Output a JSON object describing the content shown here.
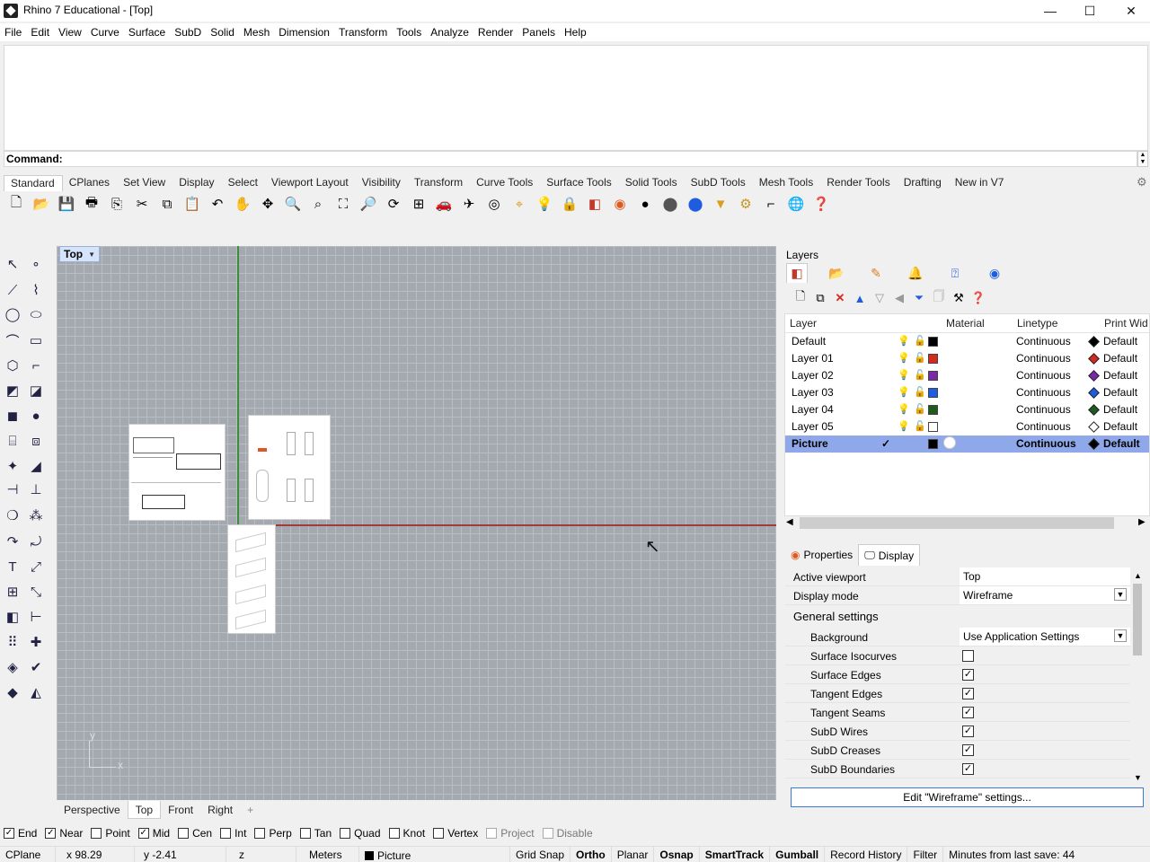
{
  "window": {
    "title": "Rhino 7 Educational - [Top]",
    "minimize": "—",
    "maximize": "☐",
    "close": "✕"
  },
  "menu": [
    "File",
    "Edit",
    "View",
    "Curve",
    "Surface",
    "SubD",
    "Solid",
    "Mesh",
    "Dimension",
    "Transform",
    "Tools",
    "Analyze",
    "Render",
    "Panels",
    "Help"
  ],
  "command": {
    "label": "Command:"
  },
  "toolbar_tabs": [
    "Standard",
    "CPlanes",
    "Set View",
    "Display",
    "Select",
    "Viewport Layout",
    "Visibility",
    "Transform",
    "Curve Tools",
    "Surface Tools",
    "Solid Tools",
    "SubD Tools",
    "Mesh Tools",
    "Render Tools",
    "Drafting",
    "New in V7"
  ],
  "toolbar_icons": [
    "new-icon",
    "open-icon",
    "save-icon",
    "print-icon",
    "import-icon",
    "cut-icon",
    "copy-icon",
    "paste-icon",
    "undo-icon",
    "pan-icon",
    "rotate-view-icon",
    "zoom-icon",
    "zoom-window-icon",
    "zoom-extents-icon",
    "zoom-selected-icon",
    "rotate-icon",
    "four-viewports-icon",
    "car-icon",
    "plane-icon",
    "circle-icon",
    "snap-icon",
    "light-icon",
    "lock-icon",
    "layer-icon",
    "color-wheel-icon",
    "sphere-icon",
    "shaded-sphere-icon",
    "rendered-sphere-icon",
    "filter-icon",
    "gear-icon",
    "dimension-icon",
    "globe-icon",
    "help-icon"
  ],
  "viewport": {
    "label": "Top",
    "triad_y": "y",
    "triad_x": "x"
  },
  "viewport_tabs": [
    "Perspective",
    "Top",
    "Front",
    "Right",
    "+"
  ],
  "layers": {
    "title": "Layers",
    "columns": {
      "layer": "Layer",
      "material": "Material",
      "linetype": "Linetype",
      "printwidth": "Print Wid"
    },
    "rows": [
      {
        "name": "Default",
        "color": "#000000",
        "linetype": "Continuous",
        "print": "Default",
        "print_color": "#000000",
        "selected": false
      },
      {
        "name": "Layer 01",
        "color": "#d42a1e",
        "linetype": "Continuous",
        "print": "Default",
        "print_color": "#d42a1e",
        "selected": false
      },
      {
        "name": "Layer 02",
        "color": "#7a2aa6",
        "linetype": "Continuous",
        "print": "Default",
        "print_color": "#7a2aa6",
        "selected": false
      },
      {
        "name": "Layer 03",
        "color": "#1e5ce0",
        "linetype": "Continuous",
        "print": "Default",
        "print_color": "#1e5ce0",
        "selected": false
      },
      {
        "name": "Layer 04",
        "color": "#1e5a1e",
        "linetype": "Continuous",
        "print": "Default",
        "print_color": "#1e5a1e",
        "selected": false
      },
      {
        "name": "Layer 05",
        "color": "#ffffff",
        "linetype": "Continuous",
        "print": "Default",
        "print_color": "#ffffff",
        "selected": false
      },
      {
        "name": "Picture",
        "color": "#000000",
        "linetype": "Continuous",
        "print": "Default",
        "print_color": "#000000",
        "selected": true,
        "current": "✓"
      }
    ]
  },
  "props": {
    "tabs": {
      "properties": "Properties",
      "display": "Display"
    },
    "active_viewport": {
      "label": "Active viewport",
      "value": "Top"
    },
    "display_mode": {
      "label": "Display mode",
      "value": "Wireframe"
    },
    "general": "General settings",
    "background": {
      "label": "Background",
      "value": "Use Application Settings"
    },
    "checks": [
      {
        "label": "Surface Isocurves",
        "checked": false
      },
      {
        "label": "Surface Edges",
        "checked": true
      },
      {
        "label": "Tangent Edges",
        "checked": true
      },
      {
        "label": "Tangent Seams",
        "checked": true
      },
      {
        "label": "SubD Wires",
        "checked": true
      },
      {
        "label": "SubD Creases",
        "checked": true
      },
      {
        "label": "SubD Boundaries",
        "checked": true
      }
    ],
    "edit_button": "Edit \"Wireframe\" settings..."
  },
  "osnaps": [
    {
      "label": "End",
      "checked": true
    },
    {
      "label": "Near",
      "checked": true
    },
    {
      "label": "Point",
      "checked": false
    },
    {
      "label": "Mid",
      "checked": true
    },
    {
      "label": "Cen",
      "checked": false
    },
    {
      "label": "Int",
      "checked": false
    },
    {
      "label": "Perp",
      "checked": false
    },
    {
      "label": "Tan",
      "checked": false
    },
    {
      "label": "Quad",
      "checked": false
    },
    {
      "label": "Knot",
      "checked": false
    },
    {
      "label": "Vertex",
      "checked": false
    },
    {
      "label": "Project",
      "checked": false,
      "disabled": true
    },
    {
      "label": "Disable",
      "checked": false,
      "disabled": true
    }
  ],
  "status": {
    "cplane": "CPlane",
    "x": "x 98.29",
    "y": "y -2.41",
    "z": "z",
    "units": "Meters",
    "layer": "Picture",
    "grid_snap": "Grid Snap",
    "ortho": "Ortho",
    "planar": "Planar",
    "osnap": "Osnap",
    "smarttrack": "SmartTrack",
    "gumball": "Gumball",
    "record_history": "Record History",
    "filter": "Filter",
    "last_save": "Minutes from last save: 44"
  }
}
